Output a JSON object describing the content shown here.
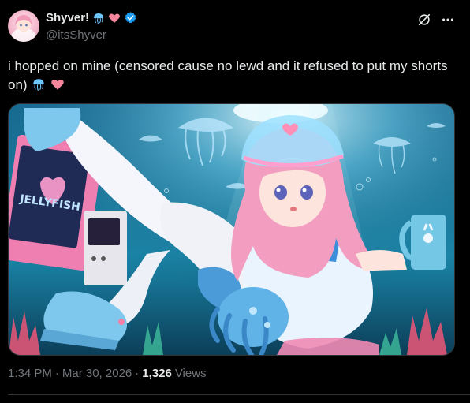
{
  "author": {
    "display_name": "Shyver!",
    "handle": "@itsShyver",
    "name_emojis": [
      "jellyfish-icon",
      "heart-icon"
    ],
    "verified": true
  },
  "tweet": {
    "text": "i hopped on mine (censored cause no lewd and it refused to put my shorts on)",
    "text_emojis": [
      "jellyfish-icon",
      "heart-icon"
    ]
  },
  "meta": {
    "time": "1:34 PM",
    "date": "Mar 30, 2026",
    "separator": "·",
    "views_count": "1,326",
    "views_label": "Views"
  },
  "media": {
    "description_icon": "anime-jellyfish-girl-image",
    "tv_screen_text": "JELLYFISH"
  },
  "colors": {
    "background": "#000000",
    "primary_text": "#e7e9ea",
    "secondary_text": "#71767b",
    "verified_blue": "#1d9bf0",
    "heart_pink": "#f4859b",
    "jellyfish_blue": "#6ec6ff",
    "divider": "#2f3336"
  }
}
